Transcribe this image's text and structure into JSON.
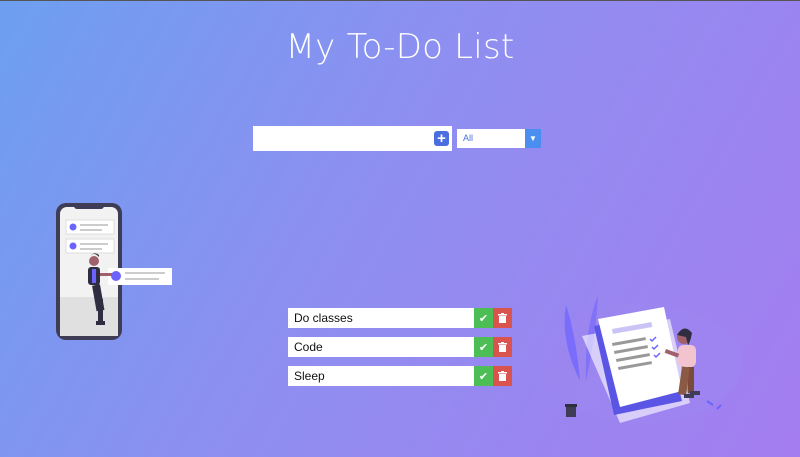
{
  "header": {
    "title": "My To-Do List"
  },
  "form": {
    "input_value": "",
    "add_icon": "plus-icon",
    "filter_selected": "All",
    "filter_icon": "caret-down-icon"
  },
  "todos": [
    {
      "text": "Do classes"
    },
    {
      "text": "Code"
    },
    {
      "text": "Sleep"
    }
  ],
  "colors": {
    "gradient_start": "#6d9ff0",
    "gradient_end": "#a47df0",
    "check": "#4dbd55",
    "trash": "#d9534f",
    "accent": "#4a6ee0"
  }
}
